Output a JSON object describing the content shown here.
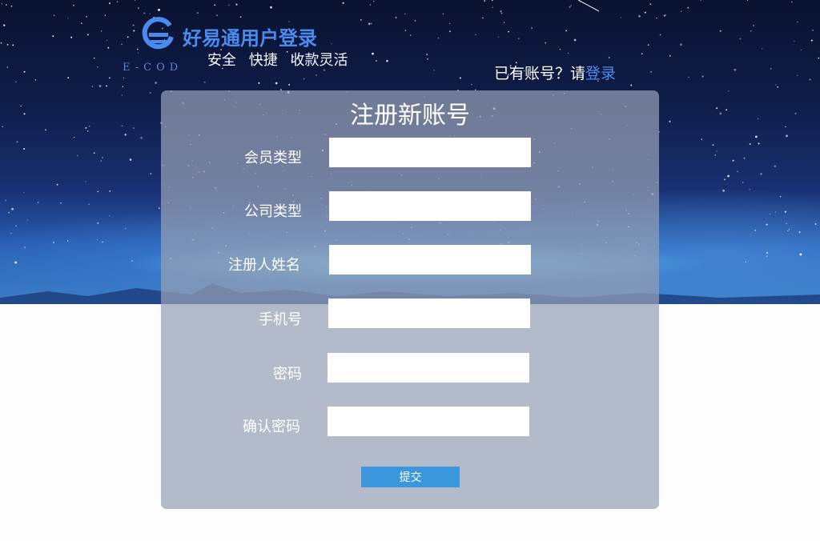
{
  "header": {
    "brand_name": "好易通用户登录",
    "brand_sub": "E-COD",
    "slogans": [
      "安全",
      "快捷",
      "收款灵活"
    ],
    "login_prompt": "已有账号？请",
    "login_link": "登录"
  },
  "form": {
    "title": "注册新账号",
    "fields": [
      {
        "label": "会员类型",
        "value": ""
      },
      {
        "label": "公司类型",
        "value": ""
      },
      {
        "label": "注册人姓名",
        "value": ""
      },
      {
        "label": "手机号",
        "value": ""
      },
      {
        "label": "密码",
        "value": ""
      },
      {
        "label": "确认密码",
        "value": ""
      }
    ],
    "submit_label": "提交"
  },
  "colors": {
    "brand_blue": "#4a8bf0",
    "link_blue": "#4f8bea",
    "submit_blue": "#3a97dd",
    "panel_gray": "#b5bac5"
  }
}
